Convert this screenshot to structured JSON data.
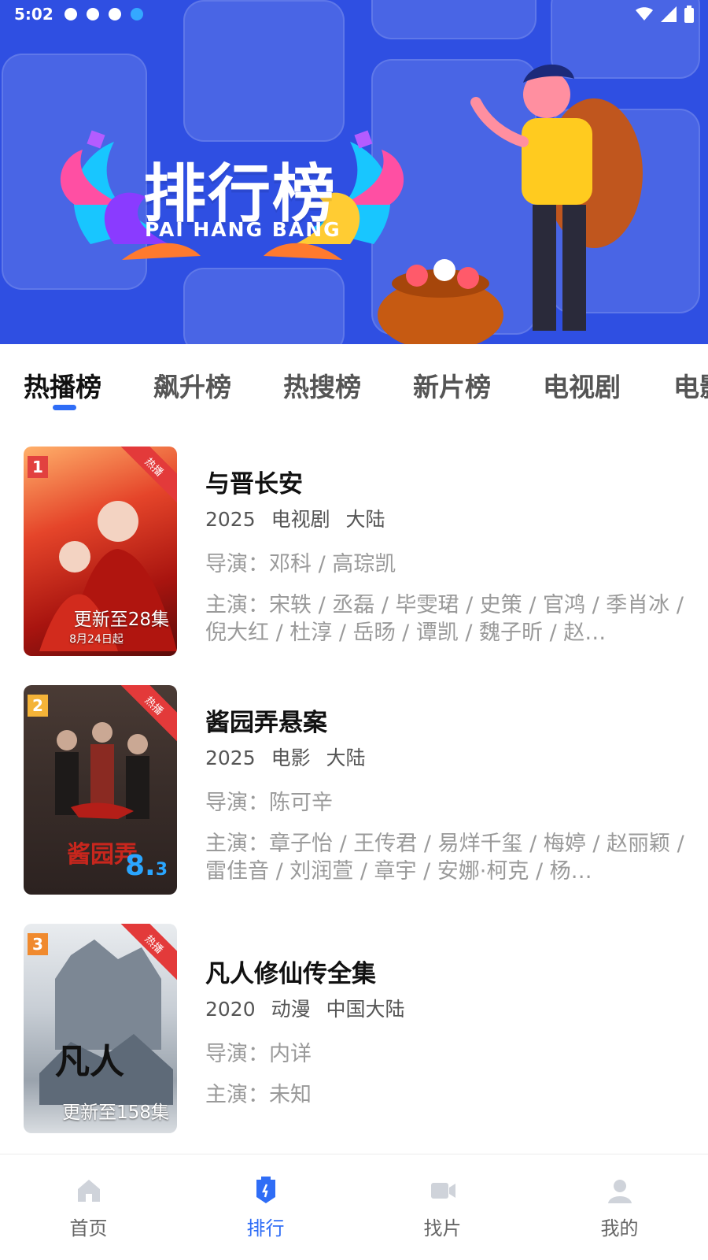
{
  "status_bar": {
    "time": "5:02"
  },
  "banner": {
    "title": "排行榜",
    "subtitle": "PAI HANG BANG",
    "background_color": "#2f4fe2"
  },
  "tabs": [
    {
      "label": "热播榜",
      "active": true
    },
    {
      "label": "飙升榜",
      "active": false
    },
    {
      "label": "热搜榜",
      "active": false
    },
    {
      "label": "新片榜",
      "active": false
    },
    {
      "label": "电视剧",
      "active": false
    },
    {
      "label": "电影",
      "active": false
    }
  ],
  "items": [
    {
      "rank": "1",
      "badge": "热播",
      "poster_caption": "更新至28集",
      "poster_caption_sub": "8月24日起",
      "poster_score": "",
      "title": "与晋长安",
      "year": "2025",
      "type": "电视剧",
      "region": "大陆",
      "director": "导演：邓科 / 高琮凯",
      "cast": "主演：宋轶 / 丞磊 / 毕雯珺 / 史策 / 官鸿 / 季肖冰 / 倪大红 / 杜淳 / 岳旸 / 谭凯 / 魏子昕 / 赵…"
    },
    {
      "rank": "2",
      "badge": "热播",
      "poster_caption": "",
      "poster_caption_sub": "",
      "poster_score": "8.3",
      "title": "酱园弄悬案",
      "year": "2025",
      "type": "电影",
      "region": "大陆",
      "director": "导演：陈可辛",
      "cast": "主演：章子怡 / 王传君 / 易烊千玺 / 梅婷 / 赵丽颖 / 雷佳音 / 刘润萱 / 章宇 / 安娜·柯克 / 杨…"
    },
    {
      "rank": "3",
      "badge": "热播",
      "poster_caption": "更新至158集",
      "poster_caption_sub": "",
      "poster_score": "",
      "title": "凡人修仙传全集",
      "year": "2020",
      "type": "动漫",
      "region": "中国大陆",
      "director": "导演：内详",
      "cast": "主演：未知"
    }
  ],
  "bottom_nav": [
    {
      "label": "首页",
      "icon": "home-icon",
      "active": false
    },
    {
      "label": "排行",
      "icon": "ranking-icon",
      "active": true
    },
    {
      "label": "找片",
      "icon": "video-camera-icon",
      "active": false
    },
    {
      "label": "我的",
      "icon": "user-icon",
      "active": false
    }
  ],
  "colors": {
    "accent": "#2f6df6",
    "rank_1": "#e2413f",
    "rank_2": "#f4b338",
    "rank_3": "#f08a2e",
    "hot_badge": "#e33a3a"
  }
}
